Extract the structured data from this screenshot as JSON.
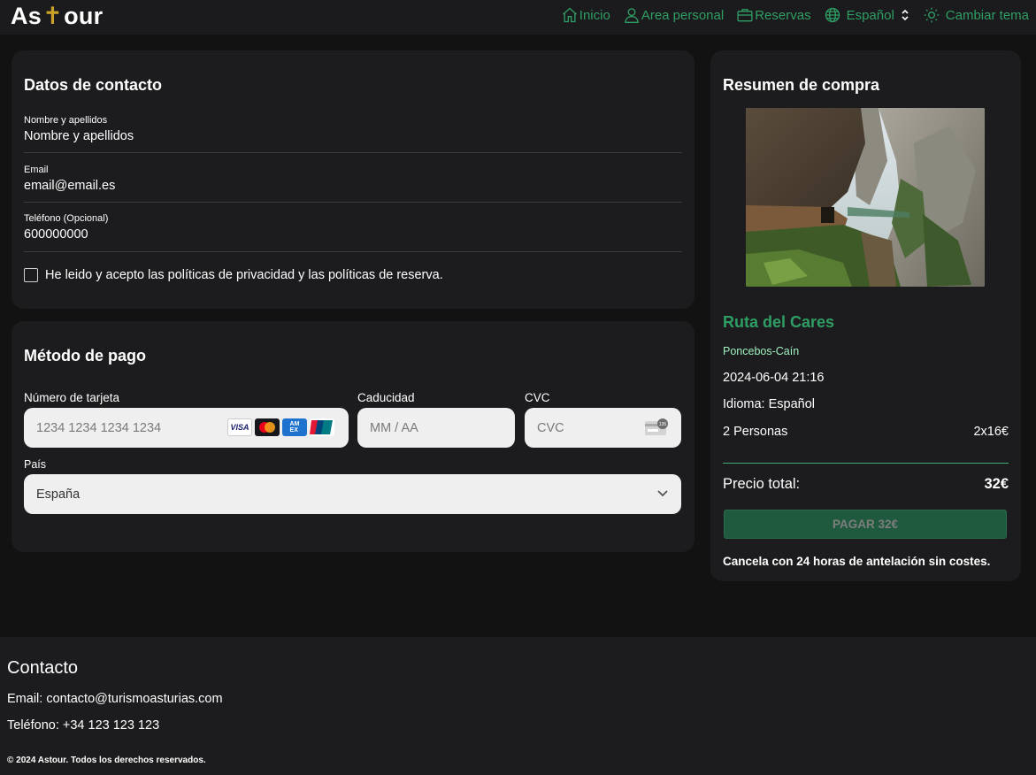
{
  "header": {
    "logo_left": "As",
    "logo_cross": "✝",
    "logo_right": "our",
    "nav": {
      "home": "Inicio",
      "personal": "Area personal",
      "bookings": "Reservas",
      "language": "Español",
      "theme": "Cambiar tema"
    }
  },
  "contact": {
    "title": "Datos de contacto",
    "name_label": "Nombre y apellidos",
    "name_value": "Nombre y apellidos",
    "email_label": "Email",
    "email_value": "email@email.es",
    "phone_label": "Teléfono (Opcional)",
    "phone_value": "600000000",
    "policy_text": "He leido y acepto las políticas de privacidad y las políticas de reserva.",
    "policy_checked": false
  },
  "payment": {
    "title": "Método de pago",
    "card_label": "Número de tarjeta",
    "card_placeholder": "1234 1234 1234 1234",
    "expiry_label": "Caducidad",
    "expiry_placeholder": "MM / AA",
    "cvc_label": "CVC",
    "cvc_placeholder": "CVC",
    "country_label": "País",
    "country_value": "España",
    "brands": [
      "VISA",
      "Mastercard",
      "AMEX",
      "UnionPay"
    ]
  },
  "summary": {
    "title": "Resumen de compra",
    "tour_name": "Ruta del Cares",
    "route": "Poncebos-Caín",
    "datetime": "2024-06-04 21:16",
    "language_line": "Idioma: Español",
    "people": "2 Personas",
    "people_price": "2x16€",
    "total_label": "Precio total:",
    "total_value": "32€",
    "pay_button": "PAGAR 32€",
    "cancel_note": "Cancela con 24 horas de antelación sin costes."
  },
  "footer": {
    "title": "Contacto",
    "email_line": "Email: contacto@turismoasturias.com",
    "phone_line": "Teléfono: +34 123 123 123",
    "copyright": "© 2024 Astour. Todos los derechos reservados."
  },
  "colors": {
    "accent": "#2f9e64",
    "background": "#121212",
    "card": "#1c1c1e",
    "button": "#1f5a3e"
  },
  "icons": [
    "home-icon",
    "user-icon",
    "briefcase-icon",
    "globe-icon",
    "updown-icon",
    "sun-icon",
    "chevron-down-icon",
    "cvc-card-icon"
  ]
}
